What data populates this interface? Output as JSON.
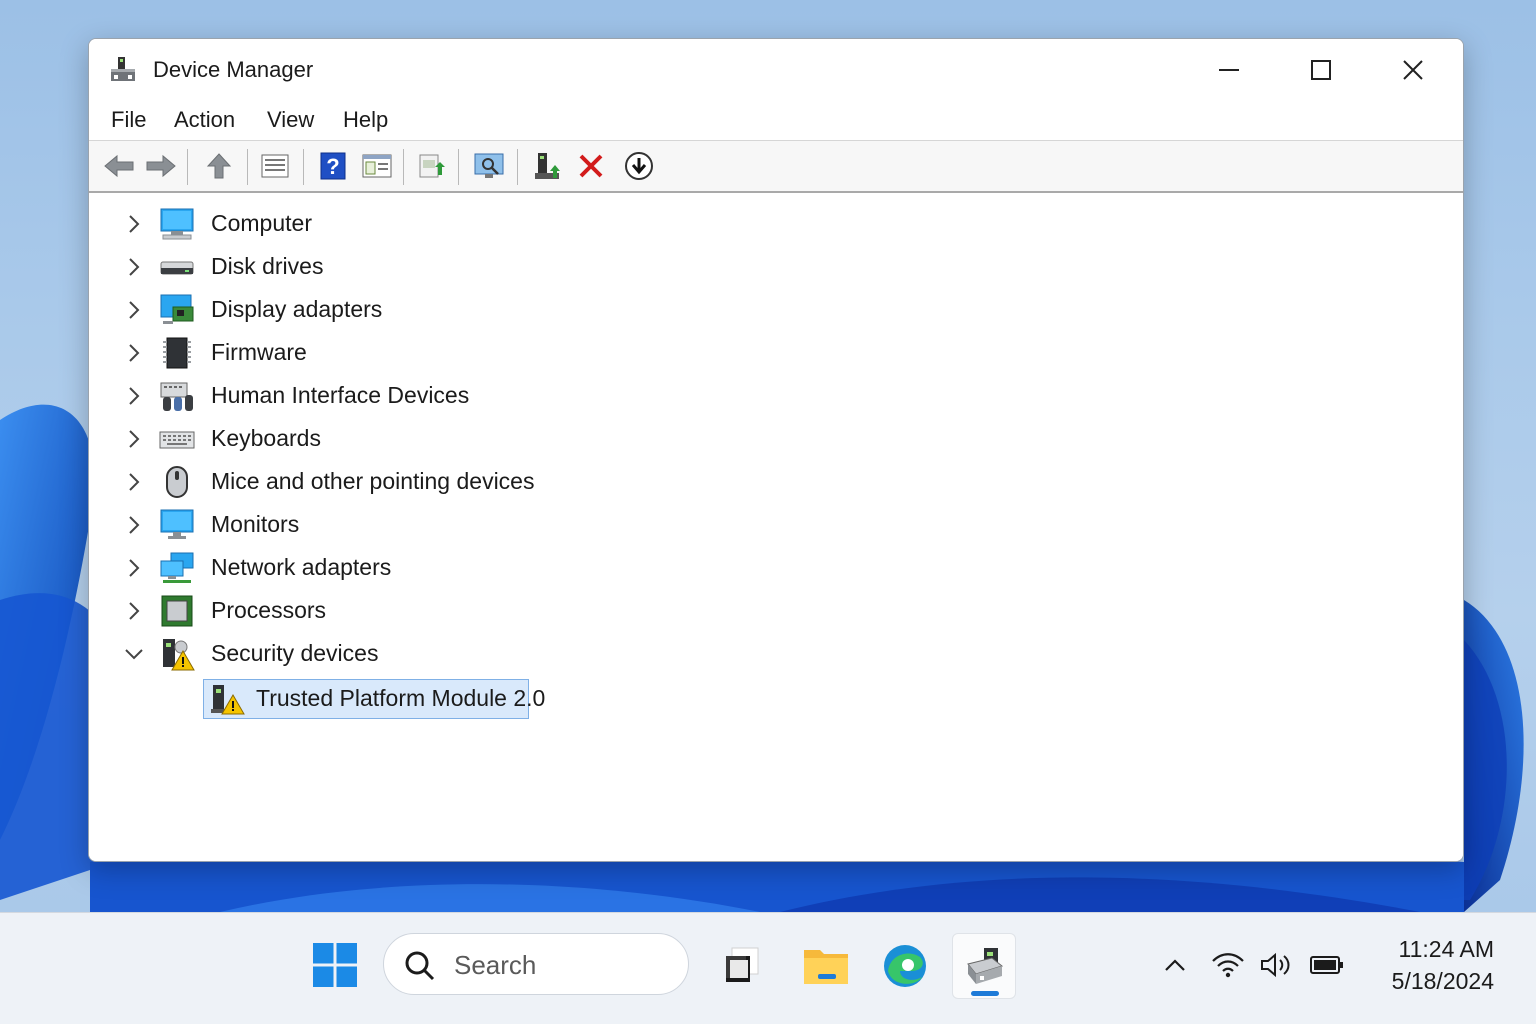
{
  "window": {
    "title": "Device Manager",
    "controls": {
      "minimize": "minimize",
      "maximize": "maximize",
      "close": "close"
    }
  },
  "menu": [
    "File",
    "Action",
    "View",
    "Help"
  ],
  "toolbar": [
    "back-arrow-icon",
    "forward-arrow-icon",
    "up-one-level-icon",
    "properties-sheet-icon",
    "help-icon",
    "show-hide-console-tree-icon",
    "update-driver-icon",
    "scan-hardware-icon",
    "enable-device-icon",
    "uninstall-device-icon",
    "download-icon"
  ],
  "tree": {
    "categories": [
      {
        "label": "Computer",
        "icon": "computer-icon",
        "expanded": false
      },
      {
        "label": "Disk drives",
        "icon": "disk-drive-icon",
        "expanded": false
      },
      {
        "label": "Display adapters",
        "icon": "display-adapter-icon",
        "expanded": false
      },
      {
        "label": "Firmware",
        "icon": "firmware-chip-icon",
        "expanded": false
      },
      {
        "label": "Human Interface Devices",
        "icon": "hid-icon",
        "expanded": false
      },
      {
        "label": "Keyboards",
        "icon": "keyboard-icon",
        "expanded": false
      },
      {
        "label": "Mice and other pointing devices",
        "icon": "mouse-icon",
        "expanded": false
      },
      {
        "label": "Monitors",
        "icon": "monitor-icon",
        "expanded": false
      },
      {
        "label": "Network adapters",
        "icon": "network-adapter-icon",
        "expanded": false
      },
      {
        "label": "Processors",
        "icon": "processor-icon",
        "expanded": false
      },
      {
        "label": "Security devices",
        "icon": "security-warning-icon",
        "expanded": true
      }
    ],
    "child": {
      "label": "Trusted Platform Module 2.0",
      "icon": "tpm-warning-icon",
      "selected": true
    }
  },
  "taskbar": {
    "search_placeholder": "Search",
    "apps": [
      "task-view-icon",
      "file-explorer-icon",
      "edge-icon",
      "device-manager-icon"
    ],
    "tray": [
      "chevron-up-icon",
      "wifi-icon",
      "volume-icon",
      "battery-icon"
    ],
    "time": "11:24 AM",
    "date": "5/18/2024"
  },
  "colors": {
    "accent": "#1e7bd8",
    "selection_bg": "#d9e9fb",
    "selection_border": "#7fb0e6",
    "warning": "#f5c400"
  }
}
